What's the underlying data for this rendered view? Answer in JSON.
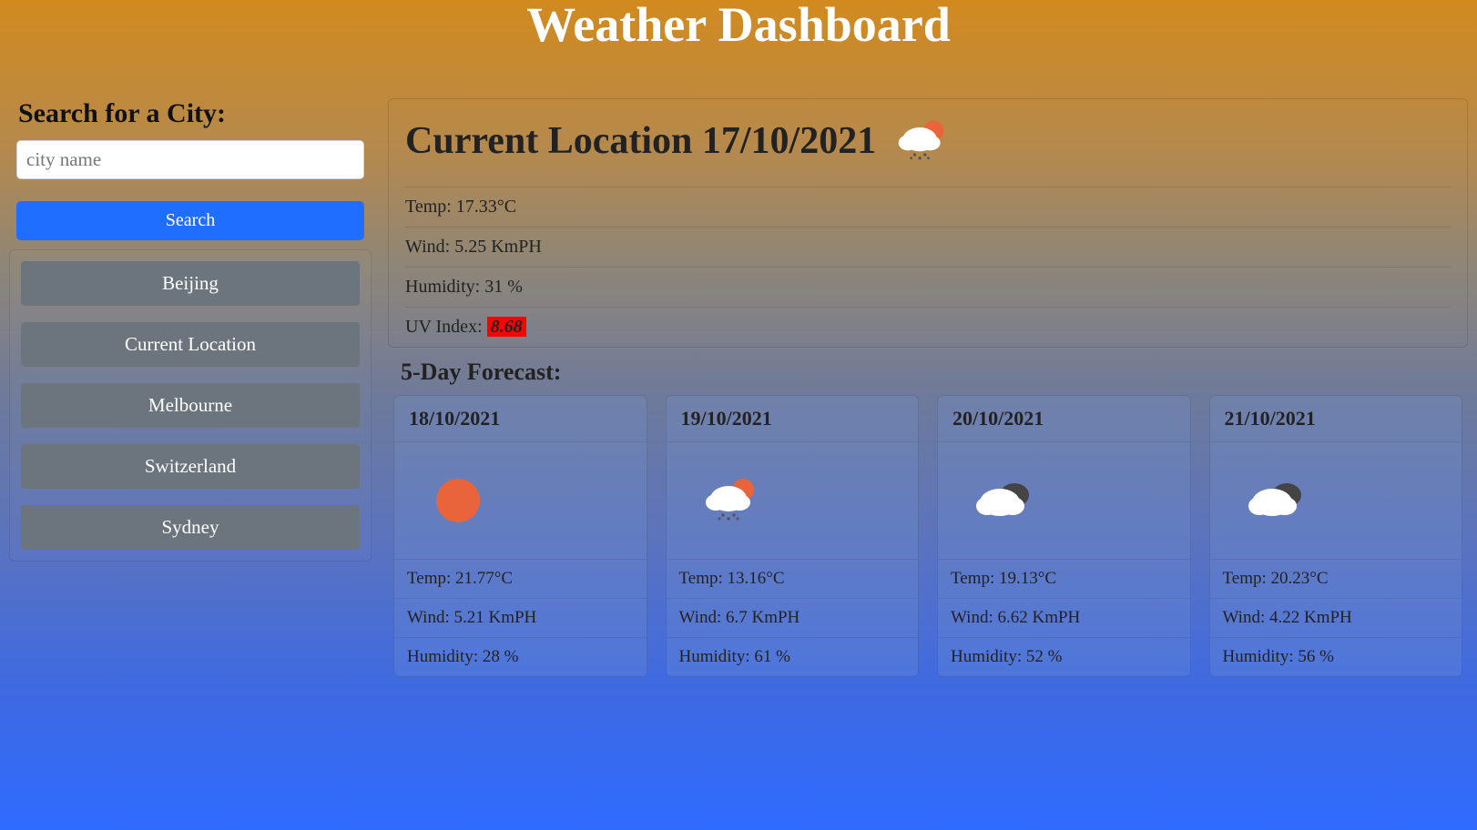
{
  "title": "Weather Dashboard",
  "sidebar": {
    "heading": "Search for a City:",
    "placeholder": "city name",
    "search_label": "Search",
    "history": [
      "Beijing",
      "Current Location",
      "Melbourne",
      "Switzerland",
      "Sydney"
    ]
  },
  "current": {
    "heading": "Current Location 17/10/2021",
    "icon": "rain-sun",
    "temp": "Temp: 17.33°C",
    "wind": "Wind: 5.25 KmPH",
    "humidity": "Humidity: 31 %",
    "uv_label": "UV Index: ",
    "uv_value": "8.68"
  },
  "forecast_title": "5-Day Forecast:",
  "forecast": [
    {
      "date": "18/10/2021",
      "icon": "sun",
      "temp": "Temp: 21.77°C",
      "wind": "Wind: 5.21 KmPH",
      "humidity": "Humidity: 28 %"
    },
    {
      "date": "19/10/2021",
      "icon": "rain-sun",
      "temp": "Temp: 13.16°C",
      "wind": "Wind: 6.7 KmPH",
      "humidity": "Humidity: 61 %"
    },
    {
      "date": "20/10/2021",
      "icon": "cloudy",
      "temp": "Temp: 19.13°C",
      "wind": "Wind: 6.62 KmPH",
      "humidity": "Humidity: 52 %"
    },
    {
      "date": "21/10/2021",
      "icon": "cloudy",
      "temp": "Temp: 20.23°C",
      "wind": "Wind: 4.22 KmPH",
      "humidity": "Humidity: 56 %"
    }
  ]
}
